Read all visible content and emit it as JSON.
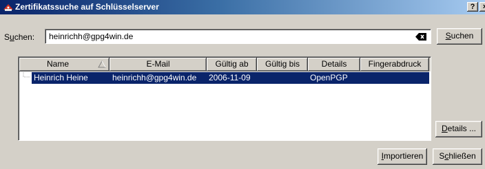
{
  "window": {
    "title": "Zertifikatssuche auf Schlüsselserver",
    "help_button": "?",
    "close_button": "×"
  },
  "search": {
    "label_pre": "S",
    "label_ul": "u",
    "label_post": "chen:",
    "value": "heinrichh@gpg4win.de",
    "button_ul": "S",
    "button_rest": "uchen"
  },
  "table": {
    "columns": [
      "Name",
      "E-Mail",
      "Gültig ab",
      "Gültig bis",
      "Details",
      "Fingerabdruck"
    ],
    "rows": [
      {
        "name": "Heinrich Heine",
        "email": "heinrichh@gpg4win.de",
        "valid_from": "2006-11-09",
        "valid_until": "",
        "details": "OpenPGP",
        "fingerprint": ""
      }
    ]
  },
  "buttons": {
    "details_ul": "D",
    "details_rest": "etails ...",
    "import_ul": "I",
    "import_rest": "mportieren",
    "close_pre": "S",
    "close_ul": "c",
    "close_rest": "hließen"
  },
  "colors": {
    "selection": "#0a246a",
    "dialog_bg": "#d4d0c8"
  }
}
